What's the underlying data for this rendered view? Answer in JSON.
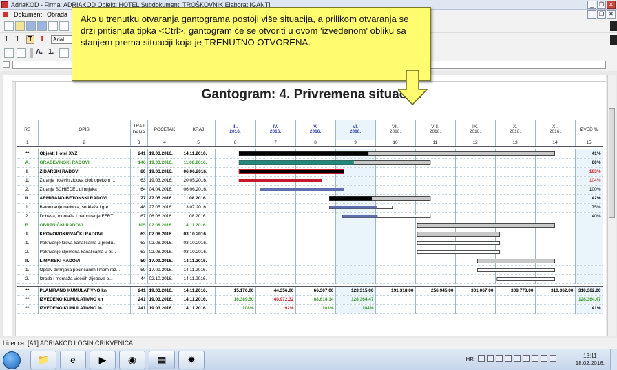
{
  "window": {
    "title": "AdriaKOD - Firma: ADRIAKOD   Objekt: HOTEL   Subdokument: TROŠKOVNIK   Elaborat [GANT]",
    "controls": [
      "_",
      "❐",
      "✕"
    ]
  },
  "menu": {
    "items": [
      "Dokument",
      "Obrada"
    ]
  },
  "toolbar": {
    "font_name": "Arial",
    "text_tools": [
      "T",
      "T",
      "T",
      "T"
    ],
    "size_labels": [
      "A.",
      "1."
    ]
  },
  "gantt": {
    "title": "Gantogram: 4. Privremena situacija",
    "headers": {
      "rb": "RB",
      "opis": "OPIS",
      "trajanje": "TRAJ DANA",
      "pocetak": "POČETAK",
      "kraj": "KRAJ",
      "izved": "IZVED %",
      "months": [
        {
          "m": "III.",
          "y": "2016."
        },
        {
          "m": "IV.",
          "y": "2016."
        },
        {
          "m": "V.",
          "y": "2016."
        },
        {
          "m": "VI.",
          "y": "2016."
        },
        {
          "m": "VII.",
          "y": "2016."
        },
        {
          "m": "VIII.",
          "y": "2016."
        },
        {
          "m": "IX.",
          "y": "2016."
        },
        {
          "m": "X.",
          "y": "2016."
        },
        {
          "m": "XI.",
          "y": "2016."
        }
      ],
      "numbers": [
        "1",
        "2",
        "3",
        "4",
        "5",
        "6",
        "7",
        "8",
        "9",
        "10",
        "11",
        "12",
        "13",
        "14",
        "15"
      ]
    },
    "rows": [
      {
        "rb": "**",
        "opis": "Objekt: Hotel XYZ",
        "traj": "241",
        "poc": "19.03.2016.",
        "kraj": "14.11.2016.",
        "izved": "41%",
        "style": "bold"
      },
      {
        "rb": "A.",
        "opis": "GRAĐEVINSKI RADOVI",
        "traj": "146",
        "poc": "19.03.2016.",
        "kraj": "11.08.2016.",
        "izved": "60%",
        "style": "green"
      },
      {
        "rb": "I.",
        "opis": "ZIDARSKI RADOVI",
        "traj": "80",
        "poc": "19.03.2016.",
        "kraj": "06.06.2016.",
        "izved": "103%",
        "style": "bold",
        "izved_color": "red"
      },
      {
        "rb": "1.",
        "opis": "Zidanje nosivih zidova blok opekom ...",
        "traj": "63",
        "poc": "19.03.2016.",
        "kraj": "20.05.2016.",
        "izved": "104%",
        "style": "normal",
        "izved_color": "red"
      },
      {
        "rb": "2.",
        "opis": "Zidanje SCHIEDEL dimnjaka",
        "traj": "64",
        "poc": "04.04.2016.",
        "kraj": "06.06.2016.",
        "izved": "100%",
        "style": "normal"
      },
      {
        "rb": "II.",
        "opis": "ARMIRANO-BETONSKI RADOVI",
        "traj": "77",
        "poc": "27.05.2016.",
        "kraj": "11.08.2016.",
        "izved": "42%",
        "style": "bold"
      },
      {
        "rb": "1.",
        "opis": "Betoniranje nadvoja, serklaža i gre...",
        "traj": "48",
        "poc": "27.05.2016.",
        "kraj": "13.07.2016.",
        "izved": "75%",
        "style": "normal"
      },
      {
        "rb": "2.",
        "opis": "Dobava, montaža i betoniranje FERT ...",
        "traj": "67",
        "poc": "06.06.2016.",
        "kraj": "11.08.2016.",
        "izved": "40%",
        "style": "normal"
      },
      {
        "rb": "B.",
        "opis": "OBRTNIČKI RADOVI",
        "traj": "105",
        "poc": "02.08.2016.",
        "kraj": "14.11.2016.",
        "izved": "",
        "style": "green"
      },
      {
        "rb": "I.",
        "opis": "KROVOPOKRIVAČKI RADOVI",
        "traj": "63",
        "poc": "02.08.2016.",
        "kraj": "03.10.2016.",
        "izved": "",
        "style": "bold"
      },
      {
        "rb": "1.",
        "opis": "Pokrivanje krova kanalicama u produ...",
        "traj": "63",
        "poc": "02.08.2016.",
        "kraj": "03.10.2016.",
        "izved": "",
        "style": "normal"
      },
      {
        "rb": "2.",
        "opis": "Pokrivanje sljemena kanalicama u pr...",
        "traj": "63",
        "poc": "02.08.2016.",
        "kraj": "03.10.2016.",
        "izved": "",
        "style": "normal"
      },
      {
        "rb": "II.",
        "opis": "LIMARSKI RADOVI",
        "traj": "59",
        "poc": "17.09.2016.",
        "kraj": "14.11.2016.",
        "izved": "",
        "style": "bold"
      },
      {
        "rb": "1.",
        "opis": "Opšav dimnjaka pocinčanim limom raz...",
        "traj": "59",
        "poc": "17.09.2016.",
        "kraj": "14.11.2016.",
        "izved": "",
        "style": "normal"
      },
      {
        "rb": "2.",
        "opis": "Izrada i montaža visećih žljebova o...",
        "traj": "44",
        "poc": "02.10.2016.",
        "kraj": "14.11.2016.",
        "izved": "",
        "style": "normal"
      }
    ],
    "summary": [
      {
        "rb": "**",
        "opis": "PLANIRANO KUMULATIVNO kn",
        "traj": "241",
        "poc": "19.03.2016.",
        "kraj": "14.11.2016.",
        "months": [
          "15.176,00",
          "44.356,00",
          "66.307,00",
          "123.315,00",
          "191.318,00",
          "256.945,00",
          "301.067,00",
          "308.778,00",
          "310.362,00"
        ],
        "month_colors": [
          "black",
          "black",
          "black",
          "black",
          "black",
          "black",
          "black",
          "black",
          "black"
        ],
        "izved": "310.362,00",
        "izved_color": "black"
      },
      {
        "rb": "**",
        "opis": "IZVEDENO KUMULATIVNO kn",
        "traj": "241",
        "poc": "19.03.2016.",
        "kraj": "14.11.2016.",
        "months": [
          "16.389,50",
          "40.972,32",
          "68.614,14",
          "128.364,47",
          "",
          "",
          "",
          "",
          ""
        ],
        "month_colors": [
          "green",
          "red",
          "green",
          "green",
          "black",
          "black",
          "black",
          "black",
          "black"
        ],
        "izved": "128.364,47",
        "izved_color": "green"
      },
      {
        "rb": "**",
        "opis": "IZVEDENO KUMULATIVNO %",
        "traj": "241",
        "poc": "19.03.2016.",
        "kraj": "14.11.2016.",
        "months": [
          "108%",
          "92%",
          "103%",
          "104%",
          "",
          "",
          "",
          "",
          ""
        ],
        "month_colors": [
          "green",
          "red",
          "green",
          "green",
          "black",
          "black",
          "black",
          "black",
          "black"
        ],
        "izved": "41%",
        "izved_color": "black"
      }
    ],
    "colors": {
      "planned": "#c8c8c8",
      "done_black": "#000000",
      "done_teal": "#1f8a7a",
      "done_red": "#c4182c",
      "done_blue": "#5f6fb0",
      "green_text": "#3b9a2c",
      "red_text": "#cc1a1a",
      "month_header": "#2a3aa7"
    }
  },
  "callout": {
    "text": "Ako u trenutku otvaranja gantograma postoji više situacija, a prilikom otvaranja se drži pritisnuta tipka <Ctrl>, gantogram će se otvoriti u ovom 'izvedenom' obliku sa stanjem prema situaciji koja je TRENUTNO OTVORENA."
  },
  "status": {
    "licence": "Licenca: [A1] ADRIAKOD LOGIN CRIKVENICA"
  },
  "taskbar": {
    "lang": "HR",
    "time": "13:11",
    "date": "18.02.2016.",
    "apps": [
      "windows-explorer",
      "internet-explorer",
      "media-player",
      "chrome",
      "adriakod",
      "app-sun"
    ]
  }
}
